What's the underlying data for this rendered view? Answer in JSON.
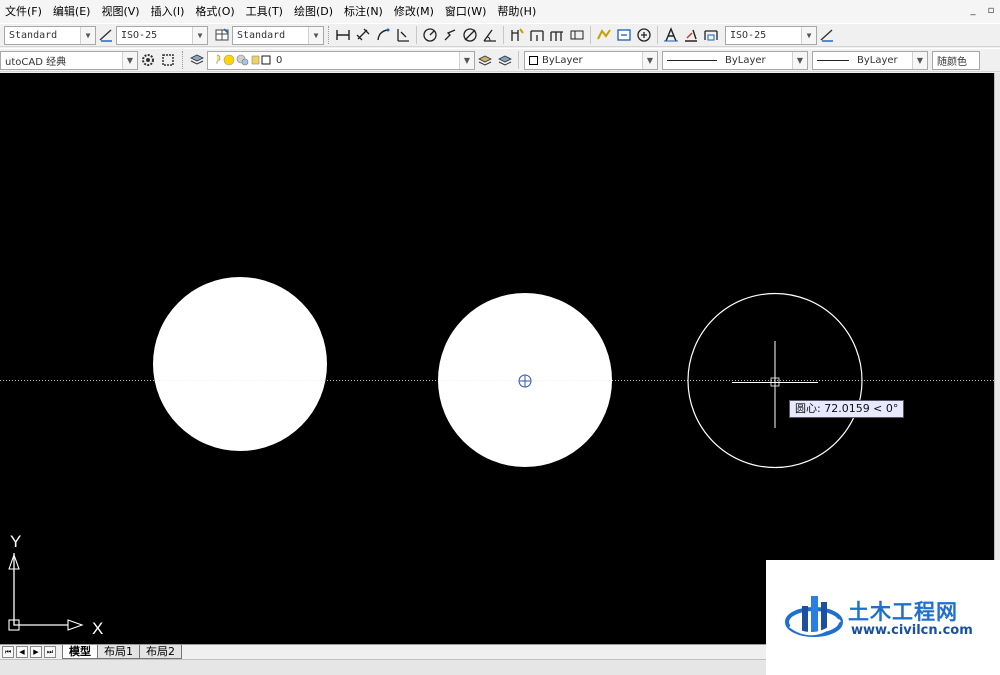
{
  "menu": [
    "文件(F)",
    "编辑(E)",
    "视图(V)",
    "插入(I)",
    "格式(O)",
    "工具(T)",
    "绘图(D)",
    "标注(N)",
    "修改(M)",
    "窗口(W)",
    "帮助(H)"
  ],
  "window_controls": {
    "minimize": "_",
    "restore": "▫"
  },
  "toolbar1": {
    "text_style": "Standard",
    "dim_style": "ISO-25",
    "table_style": "Standard",
    "mleader_style": "ISO-25"
  },
  "toolbar2": {
    "workspace": "utoCAD 经典",
    "layer_name": "0",
    "color": "ByLayer",
    "linetype": "ByLayer",
    "lineweight": "ByLayer",
    "plot_style": "随颜色"
  },
  "drawing": {
    "tooltip": "圆心: 72.0159 < 0°"
  },
  "ucs": {
    "x_label": "X",
    "y_label": "Y"
  },
  "tabs": {
    "nav": [
      "⏮",
      "◀",
      "▶",
      "⏭"
    ],
    "items": [
      "模型",
      "布局1",
      "布局2"
    ]
  },
  "watermark": {
    "title": "土木工程网",
    "url": "www.civilcn.com"
  },
  "colors": {
    "canvas": "#000000",
    "accent": "#1f6fcf"
  }
}
